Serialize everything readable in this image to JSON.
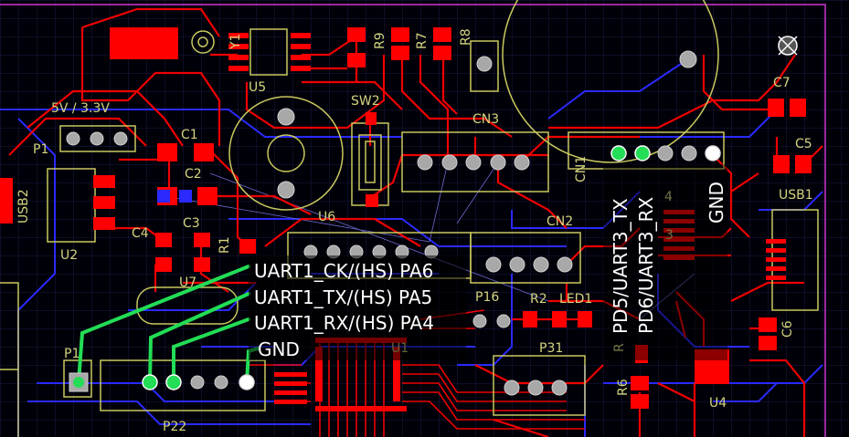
{
  "colors": {
    "background": "#000008",
    "grid": "#1a1a44",
    "top_copper": "#ff0000",
    "bottom_copper": "#2a2aff",
    "silkscreen": "#d4d480",
    "highlight_wire": "#22dd55",
    "board_outline": "#9a2aa0"
  },
  "silkscreen": {
    "voltage": "5V / 3.3V",
    "p1": "P1",
    "usb2": "USB2",
    "u2": "U2",
    "c1": "C1",
    "c2": "C2",
    "c3": "C3",
    "c4": "C4",
    "r1": "R1",
    "u7": "U7",
    "u5": "U5",
    "sw2": "SW2",
    "r9": "R9",
    "r7": "R7",
    "r8": "R8",
    "cn3": "CN3",
    "u6": "U6",
    "cn2": "CN2",
    "p16": "P16",
    "r2": "R2",
    "led1": "LED1",
    "p31": "P31",
    "u1": "U1",
    "p22": "P22",
    "pp1": "P1",
    "r6": "R6",
    "r": "R",
    "u4": "U4",
    "c7": "C7",
    "c5": "C5",
    "usb1": "USB1",
    "c6": "C6",
    "n4": "4",
    "n3": "3",
    "j1": "Y1",
    "j2": "CN1"
  },
  "labels": {
    "uart1_ck": "UART1_CK/(HS) PA6",
    "uart1_tx": "UART1_TX/(HS) PA5",
    "uart1_rx": "UART1_RX/(HS) PA4",
    "gnd_left": "GND",
    "pd5": "PD5/UART3_TX",
    "pd6": "PD6/UART3_RX",
    "gnd_right": "GND"
  }
}
